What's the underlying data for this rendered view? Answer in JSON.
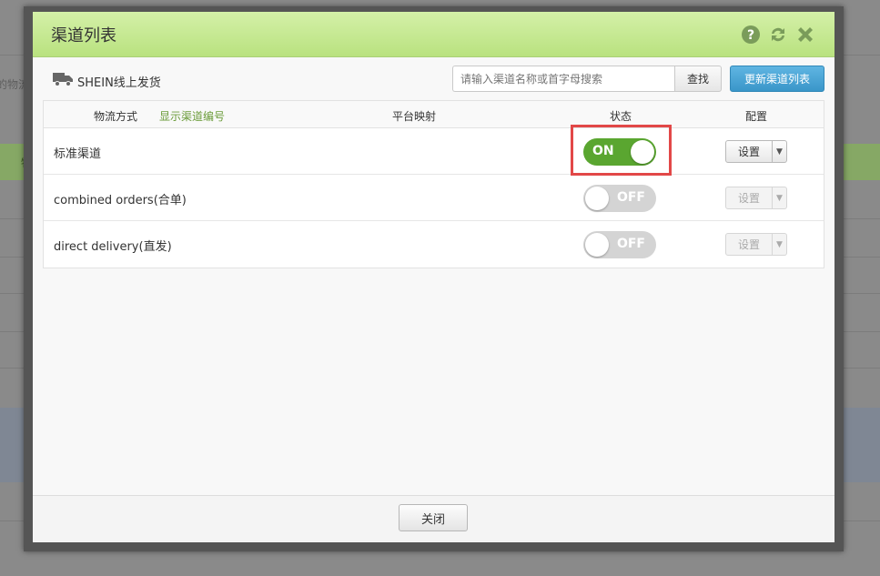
{
  "background": {
    "text_left": "的物流方",
    "text_green": "物"
  },
  "modal": {
    "title": "渠道列表",
    "icons": [
      "help-icon",
      "refresh-icon",
      "close-icon"
    ]
  },
  "toolbar": {
    "shop_name": "SHEIN线上发货",
    "search_placeholder": "请输入渠道名称或首字母搜索",
    "search_label": "查找",
    "refresh_label": "更新渠道列表"
  },
  "table": {
    "headers": {
      "method": "物流方式",
      "show_code": "显示渠道编号",
      "mapping": "平台映射",
      "status": "状态",
      "config": "配置"
    },
    "rows": [
      {
        "name": "标准渠道",
        "status": "ON",
        "enabled": true,
        "config_label": "设置"
      },
      {
        "name": "combined orders(合单)",
        "status": "OFF",
        "enabled": false,
        "config_label": "设置"
      },
      {
        "name": "direct delivery(直发)",
        "status": "OFF",
        "enabled": false,
        "config_label": "设置"
      }
    ]
  },
  "footer": {
    "close_label": "关闭"
  },
  "colors": {
    "header_green": "#b9e27f",
    "toggle_on": "#5aa630",
    "toggle_off": "#d4d4d4",
    "primary_blue": "#3a96c9",
    "highlight_red": "#e24848"
  }
}
